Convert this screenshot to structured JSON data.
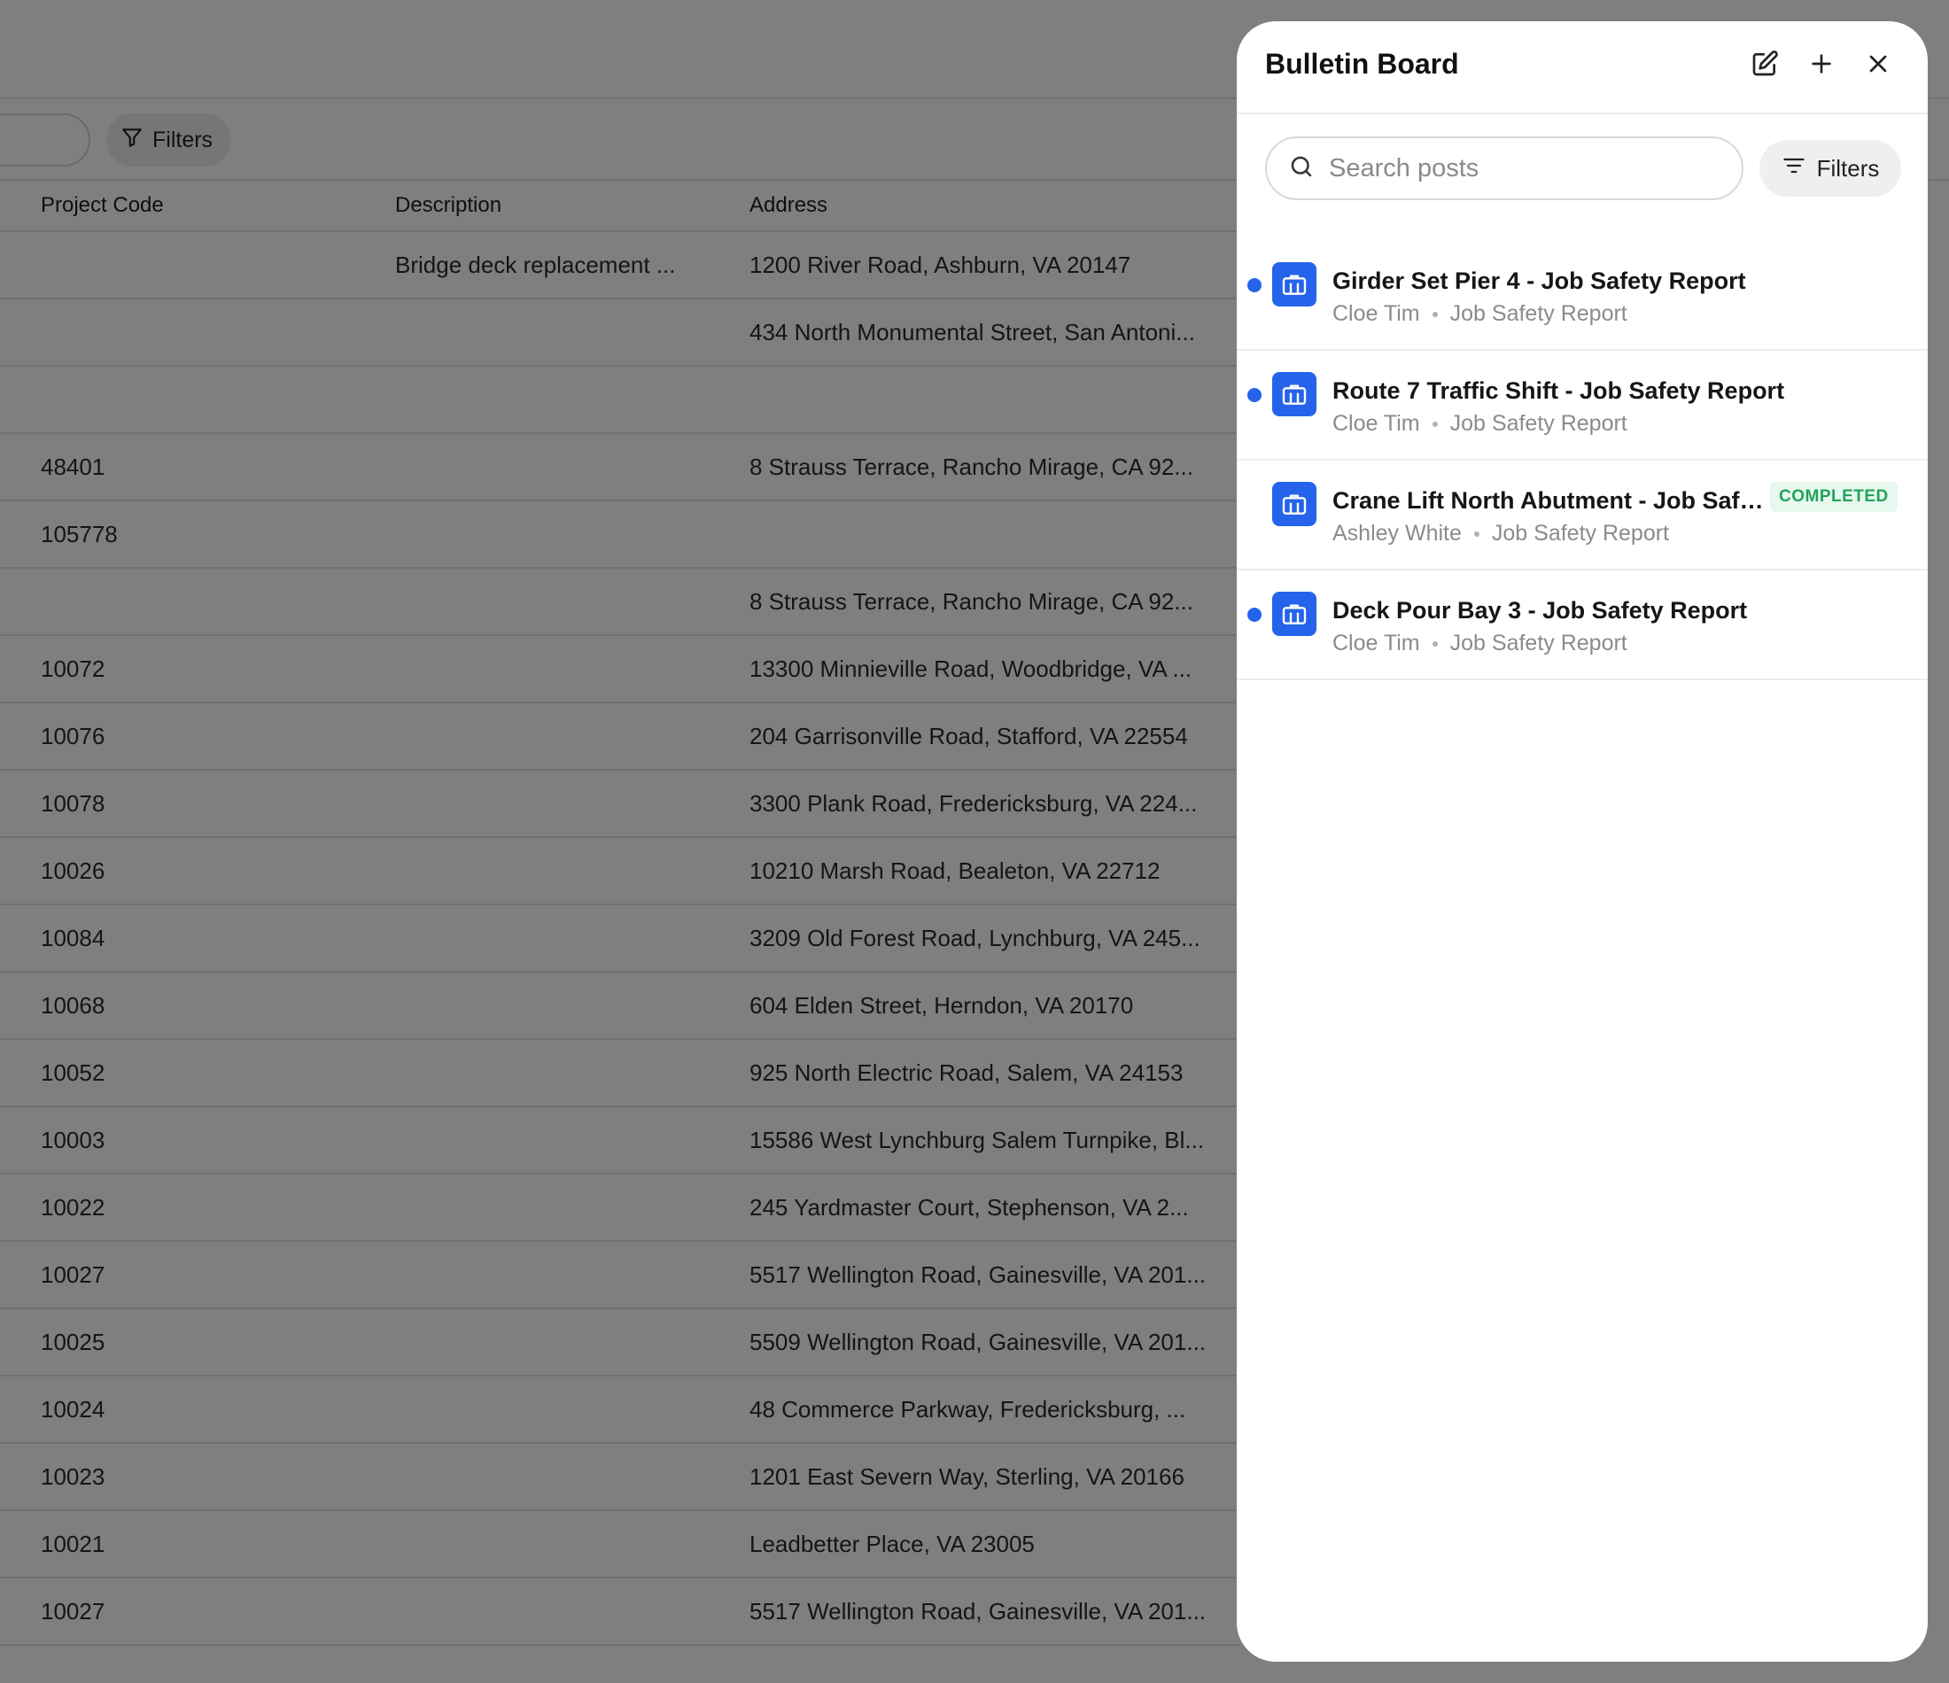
{
  "background": {
    "toolbar": {
      "filters_label": "Filters"
    },
    "table": {
      "columns": [
        "Project Code",
        "Description",
        "Address"
      ],
      "rows": [
        {
          "code": "",
          "description": "Bridge deck replacement ...",
          "address": "1200 River Road, Ashburn, VA 20147"
        },
        {
          "code": "",
          "description": "",
          "address": "434 North Monumental Street, San Antoni..."
        },
        {
          "code": "",
          "description": "",
          "address": ""
        },
        {
          "code": "48401",
          "description": "",
          "address": "8 Strauss Terrace, Rancho Mirage, CA 92..."
        },
        {
          "code": "105778",
          "description": "",
          "address": ""
        },
        {
          "code": "",
          "description": "",
          "address": "8 Strauss Terrace, Rancho Mirage, CA 92..."
        },
        {
          "code": "10072",
          "description": "",
          "address": "13300 Minnieville Road, Woodbridge, VA ..."
        },
        {
          "code": "10076",
          "description": "",
          "address": "204 Garrisonville Road, Stafford, VA 22554"
        },
        {
          "code": "10078",
          "description": "",
          "address": "3300 Plank Road, Fredericksburg, VA 224..."
        },
        {
          "code": "10026",
          "description": "",
          "address": "10210 Marsh Road, Bealeton, VA 22712"
        },
        {
          "code": "10084",
          "description": "",
          "address": "3209 Old Forest Road, Lynchburg, VA 245..."
        },
        {
          "code": "10068",
          "description": "",
          "address": "604 Elden Street, Herndon, VA 20170"
        },
        {
          "code": "10052",
          "description": "",
          "address": "925 North Electric Road, Salem, VA 24153"
        },
        {
          "code": "10003",
          "description": "",
          "address": "15586 West Lynchburg Salem Turnpike, Bl..."
        },
        {
          "code": "10022",
          "description": "",
          "address": "245 Yardmaster Court, Stephenson, VA 2..."
        },
        {
          "code": "10027",
          "description": "",
          "address": "5517 Wellington Road, Gainesville, VA 201..."
        },
        {
          "code": "10025",
          "description": "",
          "address": "5509 Wellington Road, Gainesville, VA 201..."
        },
        {
          "code": "10024",
          "description": "",
          "address": "48 Commerce Parkway, Fredericksburg, ..."
        },
        {
          "code": "10023",
          "description": "",
          "address": "1201 East Severn Way, Sterling, VA 20166"
        },
        {
          "code": "10021",
          "description": "",
          "address": "Leadbetter Place, VA 23005"
        },
        {
          "code": "10027",
          "description": "",
          "address": "5517 Wellington Road, Gainesville, VA 201..."
        }
      ]
    }
  },
  "panel": {
    "title": "Bulletin Board",
    "search": {
      "placeholder": "Search posts",
      "value": ""
    },
    "filters_label": "Filters",
    "icons": {
      "edit": "pencil-square-icon",
      "add": "plus-icon",
      "close": "close-icon",
      "search": "search-icon",
      "filter": "filter-lines-icon",
      "post": "briefcase-icon"
    },
    "colors": {
      "accent": "#2563eb",
      "completed_text": "#22a35a",
      "completed_bg": "#e7f8ee"
    },
    "posts": [
      {
        "title": "Girder Set Pier 4 - Job Safety Report",
        "author": "Cloe Tim",
        "type": "Job Safety Report",
        "unread": true,
        "status": ""
      },
      {
        "title": "Route 7 Traffic Shift - Job Safety Report",
        "author": "Cloe Tim",
        "type": "Job Safety Report",
        "unread": true,
        "status": ""
      },
      {
        "title": "Crane Lift North Abutment - Job Safet...",
        "author": "Ashley White",
        "type": "Job Safety Report",
        "unread": false,
        "status": "COMPLETED"
      },
      {
        "title": "Deck Pour Bay 3 - Job Safety Report",
        "author": "Cloe Tim",
        "type": "Job Safety Report",
        "unread": true,
        "status": ""
      }
    ]
  }
}
